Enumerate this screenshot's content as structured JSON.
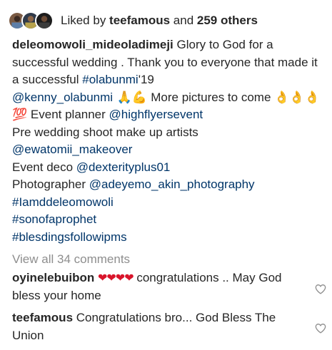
{
  "likes": {
    "prefix": "Liked by ",
    "user": "teefamous",
    "middle": " and ",
    "others": "259 others"
  },
  "caption": {
    "username": "deleomowoli_mideoladimeji",
    "text_1": " Glory to God for a successful wedding . Thank you to  everyone that made it a successful  ",
    "hashtag_1": "#olabunmi",
    "text_2": "'19",
    "mention_1": "@kenny_olabunmi",
    "emoji_1": " 🙏💪 ",
    "text_3": "More pictures to come ",
    "emoji_2": "👌👌👌💯",
    "text_4": " Event planner ",
    "mention_2": "@highflyersevent",
    "text_5": "Pre wedding shoot make up artists",
    "mention_3": "@ewatomii_makeover",
    "text_6": "Event deco ",
    "mention_4": "@dexterityplus01",
    "text_7": "Photographer ",
    "mention_5": "@adeyemo_akin_photography",
    "hashtag_2": "#Iamddeleomowoli",
    "hashtag_3": "#sonofaprophet",
    "hashtag_4": "#blesdingsfollowipms"
  },
  "view_all_comments": "View all 34 comments",
  "comments": [
    {
      "username": "oyinelebuibon",
      "hearts": "❤❤❤❤",
      "text": " congratulations .. May God bless your home"
    },
    {
      "username": "teefamous",
      "text": " Congratulations bro... God Bless The Union"
    }
  ],
  "icons": {
    "like": "heart-outline-icon"
  },
  "colors": {
    "text": "#262626",
    "link": "#003569",
    "muted": "#8e8e8e",
    "heart_red": "#d9152b"
  }
}
